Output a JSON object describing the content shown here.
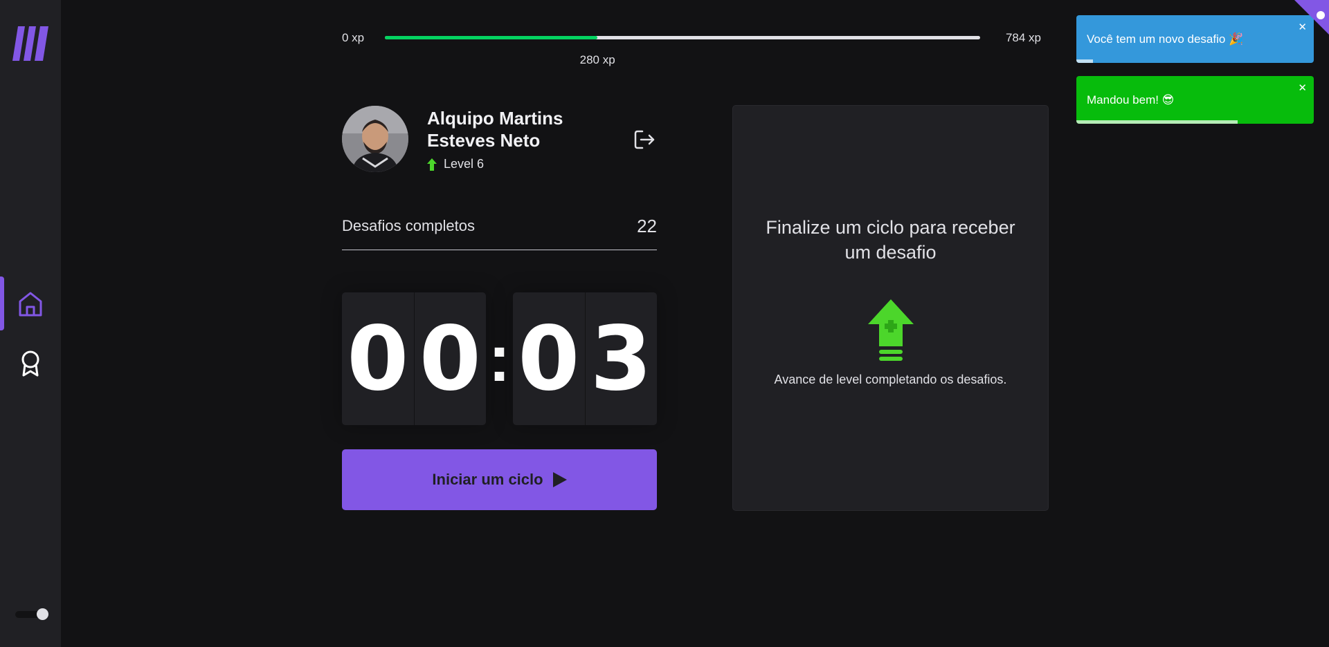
{
  "sidebar": {
    "logo": "moveit-logo",
    "nav": [
      {
        "name": "home",
        "icon": "home-icon",
        "active": true
      },
      {
        "name": "leaderboard",
        "icon": "award-icon",
        "active": false
      }
    ],
    "theme_toggle": {
      "on": true
    }
  },
  "xp": {
    "min_label": "0 xp",
    "max_label": "784 xp",
    "current_label": "280 xp",
    "current": 280,
    "max": 784,
    "fill_color": "#04d361"
  },
  "profile": {
    "name": "Alquipo Martins Esteves Neto",
    "level_label": "Level 6",
    "logout_icon": "logout-icon"
  },
  "completed_challenges": {
    "label": "Desafios completos",
    "value": "22"
  },
  "countdown": {
    "minute_left": "0",
    "minute_right": "0",
    "separator": ":",
    "second_left": "0",
    "second_right": "3"
  },
  "start_button": {
    "label": "Iniciar um ciclo",
    "icon": "play-icon"
  },
  "challenge": {
    "title": "Finalize um ciclo para receber um desafio",
    "icon": "level-up-icon",
    "text": "Avance de level completando os desafios."
  },
  "toasts": [
    {
      "text": "Você tem um novo desafio 🎉",
      "type": "info",
      "color": "#3498db",
      "progress": 0.07
    },
    {
      "text": "Mandou bem! 😎",
      "type": "success",
      "color": "#07bc0c",
      "progress": 0.68
    }
  ],
  "colors": {
    "background": "#121214",
    "panel": "#202024",
    "accent": "#8257e5",
    "success": "#04d361"
  }
}
